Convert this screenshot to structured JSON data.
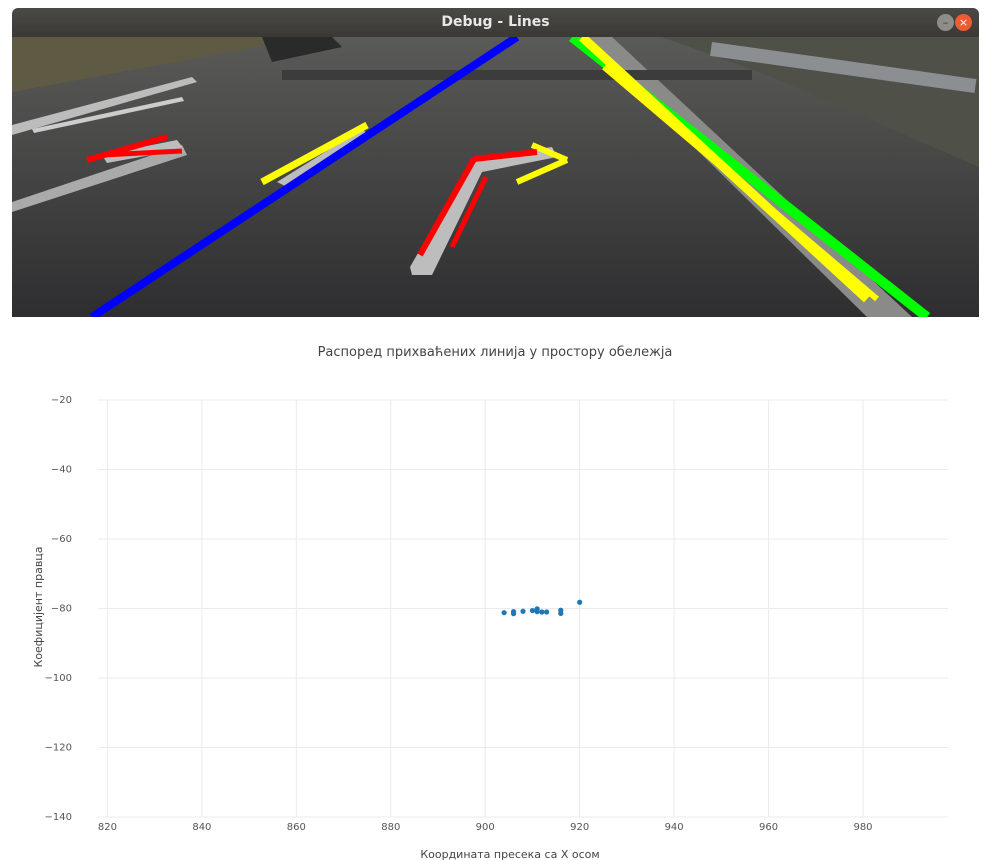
{
  "window": {
    "title": "Debug - Lines",
    "minimize_icon": "minimize-icon",
    "close_icon": "close-icon"
  },
  "colors": {
    "titlebar": "#3c3b37",
    "close_button": "#ea5c32",
    "line_blue": "#0000ff",
    "line_green": "#00ff00",
    "line_yellow": "#ffff00",
    "line_red": "#ff0000",
    "marker": "#1f77b4"
  },
  "chart_data": {
    "type": "scatter",
    "title": "Распоред прихваћених линија у простору обележја",
    "xlabel": "Координата пресека са X осом",
    "ylabel": "Коефицијент правца",
    "xlim": [
      818,
      998
    ],
    "ylim": [
      -140,
      -20
    ],
    "xticks": [
      820,
      840,
      860,
      880,
      900,
      920,
      940,
      960,
      980
    ],
    "yticks": [
      -20,
      -40,
      -60,
      -80,
      -100,
      -120,
      -140
    ],
    "grid": true,
    "legend": "none",
    "points": [
      {
        "x": 904,
        "y": -81.2
      },
      {
        "x": 906,
        "y": -80.9
      },
      {
        "x": 906,
        "y": -81.5
      },
      {
        "x": 908,
        "y": -80.8
      },
      {
        "x": 910,
        "y": -80.6
      },
      {
        "x": 911,
        "y": -80.1
      },
      {
        "x": 911,
        "y": -80.9
      },
      {
        "x": 912,
        "y": -81.0
      },
      {
        "x": 913,
        "y": -81.0
      },
      {
        "x": 916,
        "y": -80.5
      },
      {
        "x": 916,
        "y": -81.4
      },
      {
        "x": 920,
        "y": -78.2
      }
    ]
  }
}
